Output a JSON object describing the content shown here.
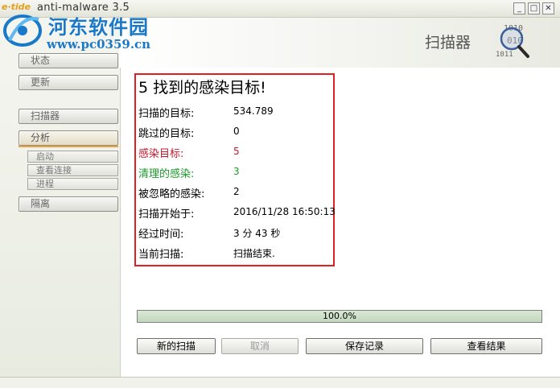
{
  "window": {
    "logo_text": "e·tide",
    "title": "anti-malware 3.5",
    "min_icon": "minimize-icon",
    "max_icon": "maximize-icon",
    "close_icon": "close-icon"
  },
  "watermark": {
    "site_name": "河东软件园",
    "url": "www.pc0359.cn"
  },
  "header": {
    "title": "扫描器",
    "icon": "magnifier-binary-icon",
    "icon_digits": [
      "1010",
      "010",
      "1011"
    ]
  },
  "sidebar": {
    "items": [
      {
        "label": "状态"
      },
      {
        "label": "更新"
      },
      {
        "label": "扫描器"
      },
      {
        "label": "分析"
      }
    ],
    "sub_items": [
      {
        "label": "启动"
      },
      {
        "label": "查看连接"
      },
      {
        "label": "进程"
      }
    ],
    "quarantine": {
      "label": "隔离"
    }
  },
  "results": {
    "heading": "5 找到的感染目标!",
    "rows": [
      {
        "label": "扫描的目标:",
        "value": "534.789"
      },
      {
        "label": "跳过的目标:",
        "value": "0"
      },
      {
        "label": "感染目标:",
        "value": "5"
      },
      {
        "label": "清理的感染:",
        "value": "3"
      },
      {
        "label": "被忽略的感染:",
        "value": "2"
      },
      {
        "label": "扫描开始于:",
        "value": "2016/11/28 16:50:13"
      },
      {
        "label": "经过时间:",
        "value": "3 分 43 秒"
      },
      {
        "label": "当前扫描:",
        "value": "扫描结束."
      }
    ]
  },
  "progress": {
    "percent": 100,
    "text": "100.0%"
  },
  "buttons": {
    "new_scan": "新的扫描",
    "cancel": "取消",
    "save_log": "保存记录",
    "view_results": "查看结果"
  },
  "colors": {
    "infected": "#c8182b",
    "cleaned": "#1a9a2a",
    "highlight_box": "#e02020",
    "watermark": "#1a78c8"
  }
}
